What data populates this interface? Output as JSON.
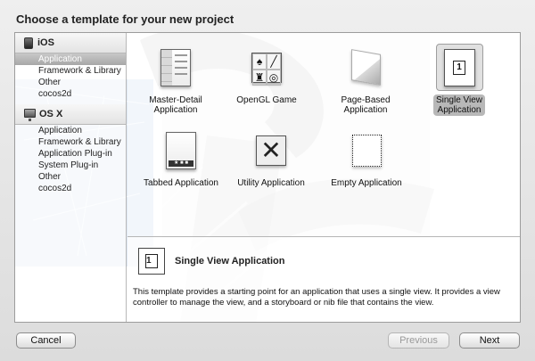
{
  "window": {
    "title": "Choose a template for your new project"
  },
  "sidebar": {
    "sections": [
      {
        "name": "iOS",
        "items": [
          "Application",
          "Framework & Library",
          "Other",
          "cocos2d"
        ]
      },
      {
        "name": "OS X",
        "items": [
          "Application",
          "Framework & Library",
          "Application Plug-in",
          "System Plug-in",
          "Other",
          "cocos2d"
        ]
      }
    ]
  },
  "templates": [
    {
      "label": "Master-Detail\nApplication",
      "icon": "master-detail-icon"
    },
    {
      "label": "OpenGL Game",
      "icon": "opengl-game-icon"
    },
    {
      "label": "Page-Based\nApplication",
      "icon": "page-based-icon"
    },
    {
      "label": "Single View\nApplication",
      "icon": "single-view-icon",
      "selected": true
    },
    {
      "label": "Tabbed Application",
      "icon": "tabbed-icon"
    },
    {
      "label": "Utility Application",
      "icon": "utility-icon"
    },
    {
      "label": "Empty Application",
      "icon": "empty-icon"
    }
  ],
  "description": {
    "icon_number": "1",
    "title": "Single View Application",
    "text": "This template provides a starting point for an application that uses a single view. It provides a view controller to manage the view, and a storyboard or nib file that contains the view."
  },
  "buttons": {
    "cancel": "Cancel",
    "previous": "Previous",
    "next": "Next"
  },
  "colors": {
    "selection": "#b8b8b8",
    "blueprint": "#5f8fcf"
  }
}
